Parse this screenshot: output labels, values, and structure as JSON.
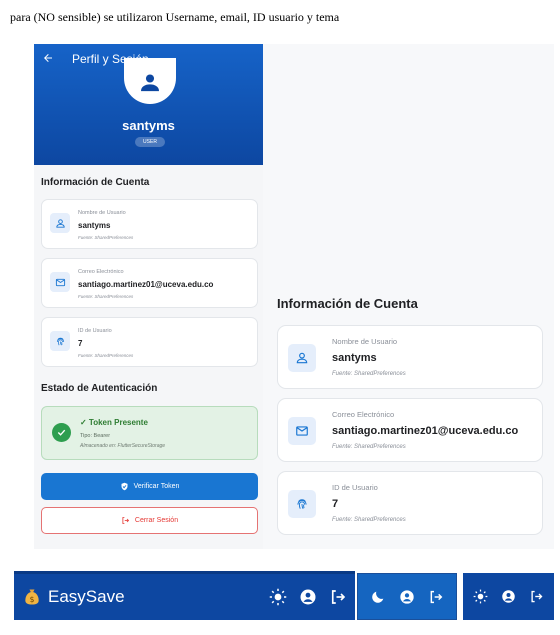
{
  "caption": "para (NO sensible) se utilizaron Username, email, ID usuario y tema",
  "profile": {
    "title": "Perfil y Sesión",
    "username": "santyms",
    "role": "USER"
  },
  "account_section": {
    "title": "Información de Cuenta",
    "items": [
      {
        "label": "Nombre de Usuario",
        "value": "santyms",
        "source": "Fuente: SharedPreferences",
        "icon": "person-icon"
      },
      {
        "label": "Correo Electrónico",
        "value": "santiago.martinez01@uceva.edu.co",
        "source": "Fuente: SharedPreferences",
        "icon": "email-icon"
      },
      {
        "label": "ID de Usuario",
        "value": "7",
        "source": "Fuente: SharedPreferences",
        "icon": "fingerprint-icon"
      }
    ]
  },
  "auth_section": {
    "title": "Estado de Autenticación",
    "token_title": "✓ Token Presente",
    "token_type": "Tipo: Bearer",
    "token_storage": "Almacenado en: FlutterSecureStorage",
    "verify_label": "Verificar Token",
    "logout_label": "Cerrar Sesión"
  },
  "appbar": {
    "title": "EasySave",
    "icons": [
      "sun-icon",
      "account-circle-icon",
      "logout-icon"
    ]
  },
  "variants": [
    {
      "icons": [
        "moon-icon",
        "account-circle-icon",
        "logout-icon"
      ]
    },
    {
      "icons": [
        "sun-icon",
        "account-circle-icon",
        "logout-icon"
      ]
    }
  ],
  "colors": {
    "primary": "#1976d2",
    "primary_dark": "#0d47a1",
    "success": "#2e9e4f",
    "danger": "#e53935"
  }
}
